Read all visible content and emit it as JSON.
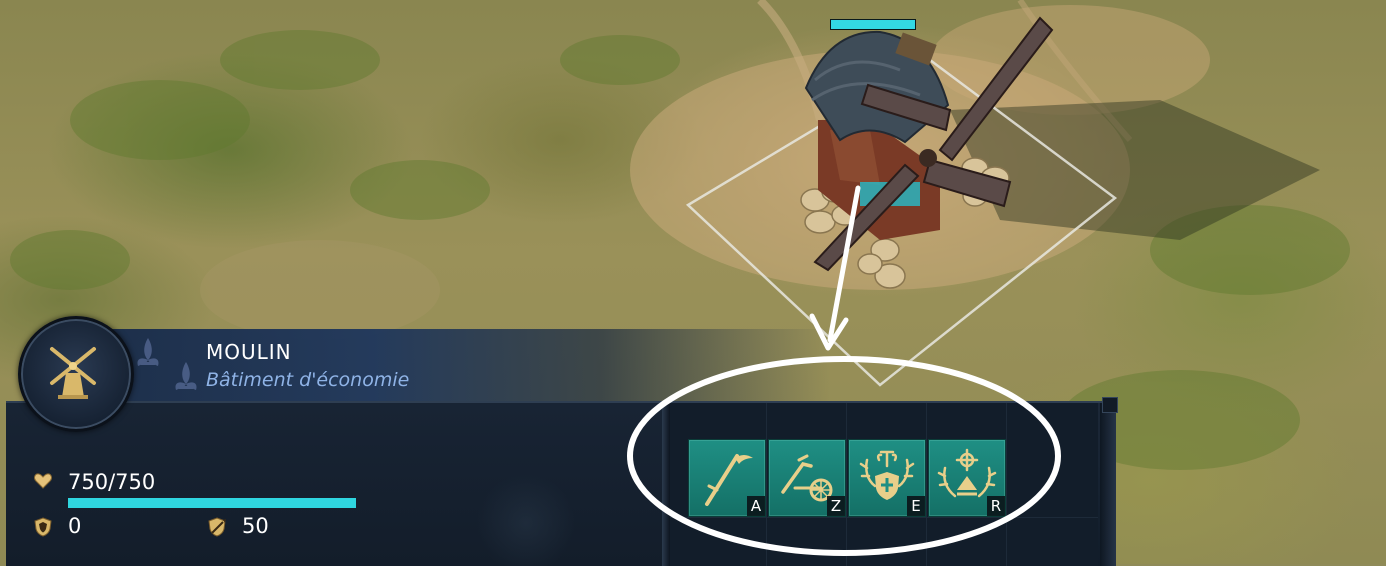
{
  "unit": {
    "name": "MOULIN",
    "type": "Bâtiment d'économie",
    "portrait_icon": "windmill-icon"
  },
  "stats": {
    "hp_text": "750/750",
    "hp_fraction": 1.0,
    "hp_icon": "heart-icon",
    "melee_armor": "0",
    "melee_armor_icon": "shield-icon",
    "ranged_armor": "50",
    "ranged_armor_icon": "arrow-shield-icon"
  },
  "commands": [
    {
      "icon": "scythe-icon",
      "hotkey": "A"
    },
    {
      "icon": "plow-icon",
      "hotkey": "Z"
    },
    {
      "icon": "antler-hammer-shield-icon",
      "hotkey": "E"
    },
    {
      "icon": "antler-compass-icon",
      "hotkey": "R"
    }
  ],
  "world": {
    "selected_building_hp_fraction": 1.0
  },
  "colors": {
    "health": "#2fd6e0",
    "command_bg": "#1f8f84",
    "accent_text": "#8fb3e6",
    "annotation": "#ffffff"
  }
}
